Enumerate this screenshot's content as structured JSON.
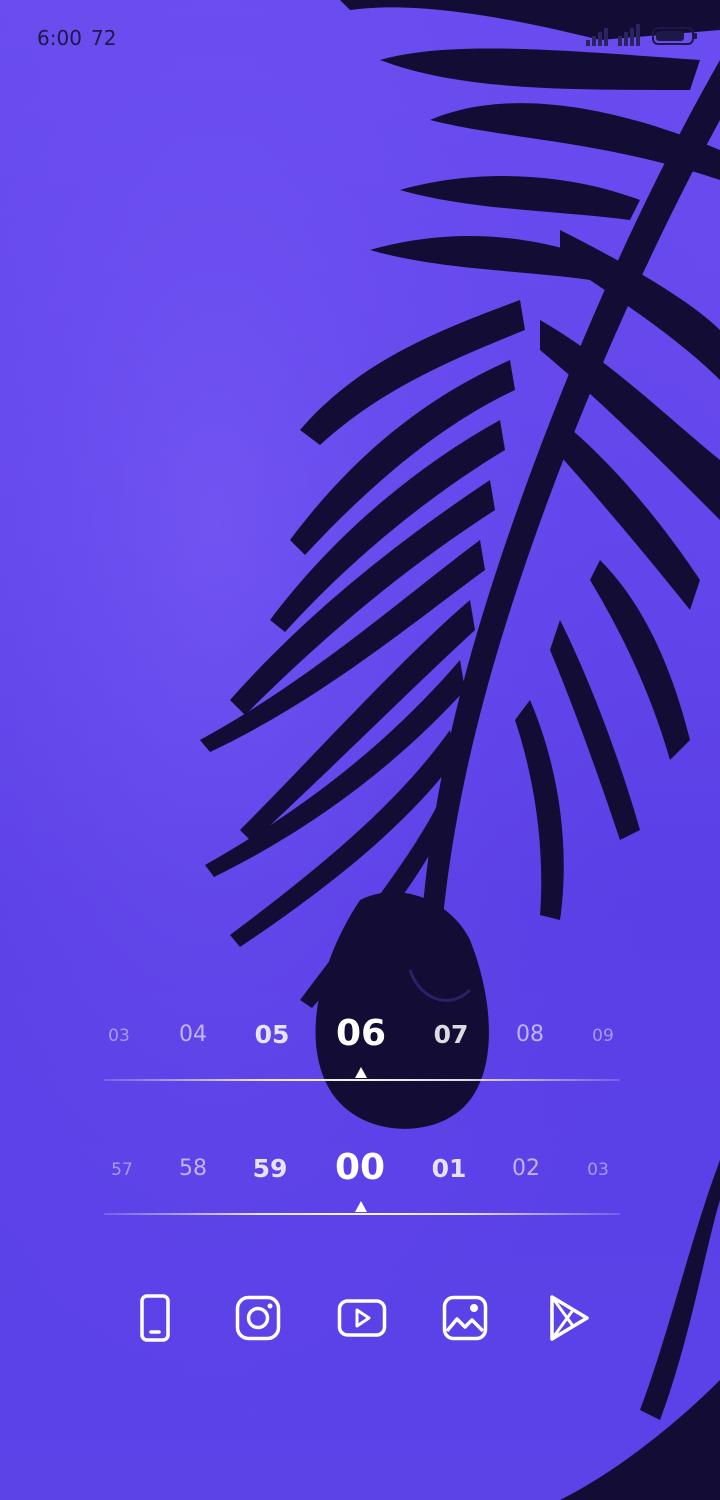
{
  "status_bar": {
    "time": "6:00",
    "battery_level": "72",
    "signal_icon": "signal-bars-icon",
    "battery_icon": "battery-icon"
  },
  "clock": {
    "hours": {
      "values": [
        "03",
        "04",
        "05",
        "06",
        "07",
        "08",
        "09"
      ],
      "selected": "06"
    },
    "minutes": {
      "values": [
        "57",
        "58",
        "59",
        "00",
        "01",
        "02",
        "03"
      ],
      "selected": "00"
    }
  },
  "dock": {
    "apps": [
      {
        "icon": "phone-icon",
        "name": "phone"
      },
      {
        "icon": "instagram-icon",
        "name": "instagram"
      },
      {
        "icon": "youtube-icon",
        "name": "youtube"
      },
      {
        "icon": "gallery-icon",
        "name": "gallery"
      },
      {
        "icon": "play-store-icon",
        "name": "play-store"
      }
    ]
  },
  "colors": {
    "background": "#6447ec",
    "foliage": "#140e38",
    "foreground": "#ffffff"
  }
}
